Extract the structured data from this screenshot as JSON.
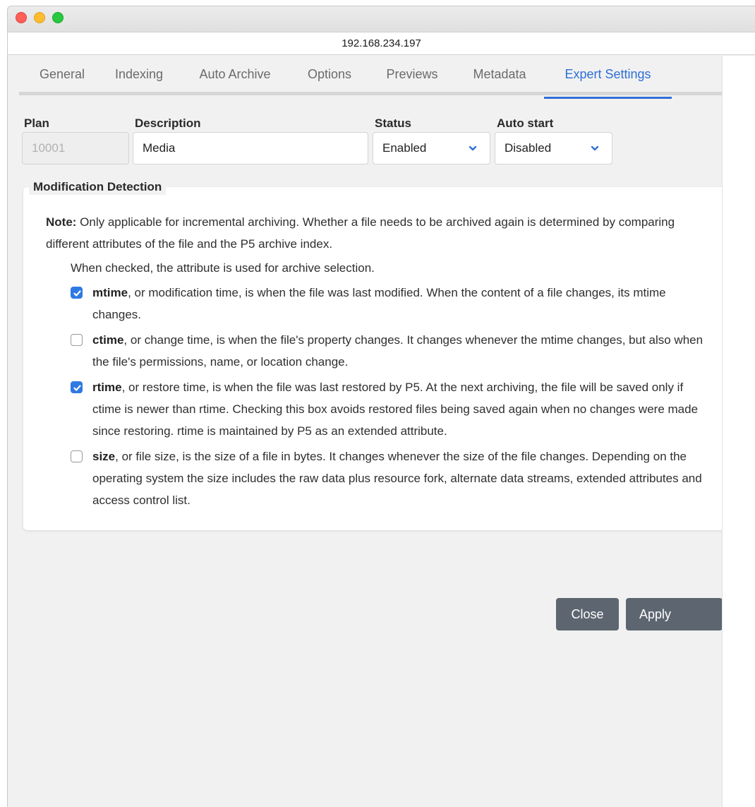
{
  "window": {
    "url": "192.168.234.197"
  },
  "tabs": [
    {
      "label": "General"
    },
    {
      "label": "Indexing"
    },
    {
      "label": "Auto Archive"
    },
    {
      "label": "Options"
    },
    {
      "label": "Previews"
    },
    {
      "label": "Metadata"
    },
    {
      "label": "Expert Settings",
      "active": true
    }
  ],
  "fields": {
    "plan": {
      "label": "Plan",
      "value": "10001"
    },
    "description": {
      "label": "Description",
      "value": "Media"
    },
    "status": {
      "label": "Status",
      "value": "Enabled"
    },
    "auto_start": {
      "label": "Auto start",
      "value": "Disabled"
    }
  },
  "modification_detection": {
    "title": "Modification Detection",
    "note_label": "Note:",
    "note_text": " Only applicable for incremental archiving. Whether a file needs to be archived again is determined by comparing different attributes of the file and the P5 archive index.",
    "hint": "When checked, the attribute is used for archive selection.",
    "options": [
      {
        "name": "mtime",
        "checked": true,
        "text": ", or modification time, is when the file was last modified. When the content of a file changes, its mtime changes."
      },
      {
        "name": "ctime",
        "checked": false,
        "text": ", or change time, is when the file's property changes. It changes whenever the mtime changes, but also when the file's permissions, name, or location change."
      },
      {
        "name": "rtime",
        "checked": true,
        "text": ", or restore time, is when the file was last restored by P5. At the next archiving, the file will be saved only if ctime is newer than rtime. Checking this box avoids restored files being saved again when no changes were made since restoring. rtime is maintained by P5 as an extended attribute."
      },
      {
        "name": "size",
        "checked": false,
        "text": ", or file size, is the size of a file in bytes. It changes whenever the size of the file changes. Depending on the operating system the size includes the raw data plus resource fork, alternate data streams, extended attributes and access control list."
      }
    ]
  },
  "buttons": {
    "close": "Close",
    "apply": "Apply"
  },
  "colors": {
    "accent": "#2f6fd6",
    "checkbox": "#2f79e3",
    "button": "#5d6670"
  }
}
